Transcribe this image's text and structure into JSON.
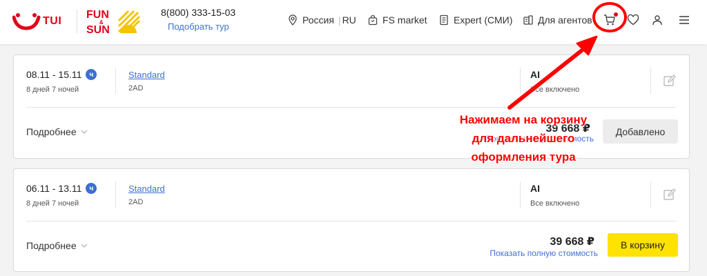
{
  "header": {
    "phone": "8(800) 333-15-03",
    "pick_tour": "Подобрать тур",
    "nav": {
      "region": "Россия",
      "region_code": "RU",
      "fs_market": "FS market",
      "expert": "Expert (СМИ)",
      "agents": "Для агентов"
    },
    "logo_tui": "TUI",
    "logo_fs_top": "FUN",
    "logo_fs_mid": "&",
    "logo_fs_bottom": "SUN",
    "icons": [
      "location-icon",
      "bag-icon",
      "document-icon",
      "agent-icon",
      "cart-icon",
      "heart-icon",
      "user-icon",
      "menu-icon"
    ]
  },
  "cards": [
    {
      "dates": "08.11 - 15.11",
      "night_badge": "ч",
      "duration": "8 дней 7 ночей",
      "room": "Standard",
      "room_code": "2AD",
      "meal_code": "AI",
      "meal_desc": "Все включено",
      "more": "Подробнее",
      "price": "39 668 ₽",
      "full_cost": "Показать полную стоимость",
      "button": "Добавлено"
    },
    {
      "dates": "06.11 - 13.11",
      "night_badge": "ч",
      "duration": "8 дней 7 ночей",
      "room": "Standard",
      "room_code": "2AD",
      "meal_code": "AI",
      "meal_desc": "Все включено",
      "more": "Подробнее",
      "price": "39 668 ₽",
      "full_cost": "Показать полную стоимость",
      "button": "В корзину"
    }
  ],
  "annotation": {
    "line1": "Нажимаем на корзину",
    "line2": "для дальнейшего",
    "line3": "оформления тура"
  },
  "colors": {
    "tui_red": "#e2001a",
    "link_blue": "#3d6fd3",
    "cart_yellow": "#ffe200",
    "annotation_red": "#ff0000",
    "fs_yellow": "#f5c400"
  }
}
